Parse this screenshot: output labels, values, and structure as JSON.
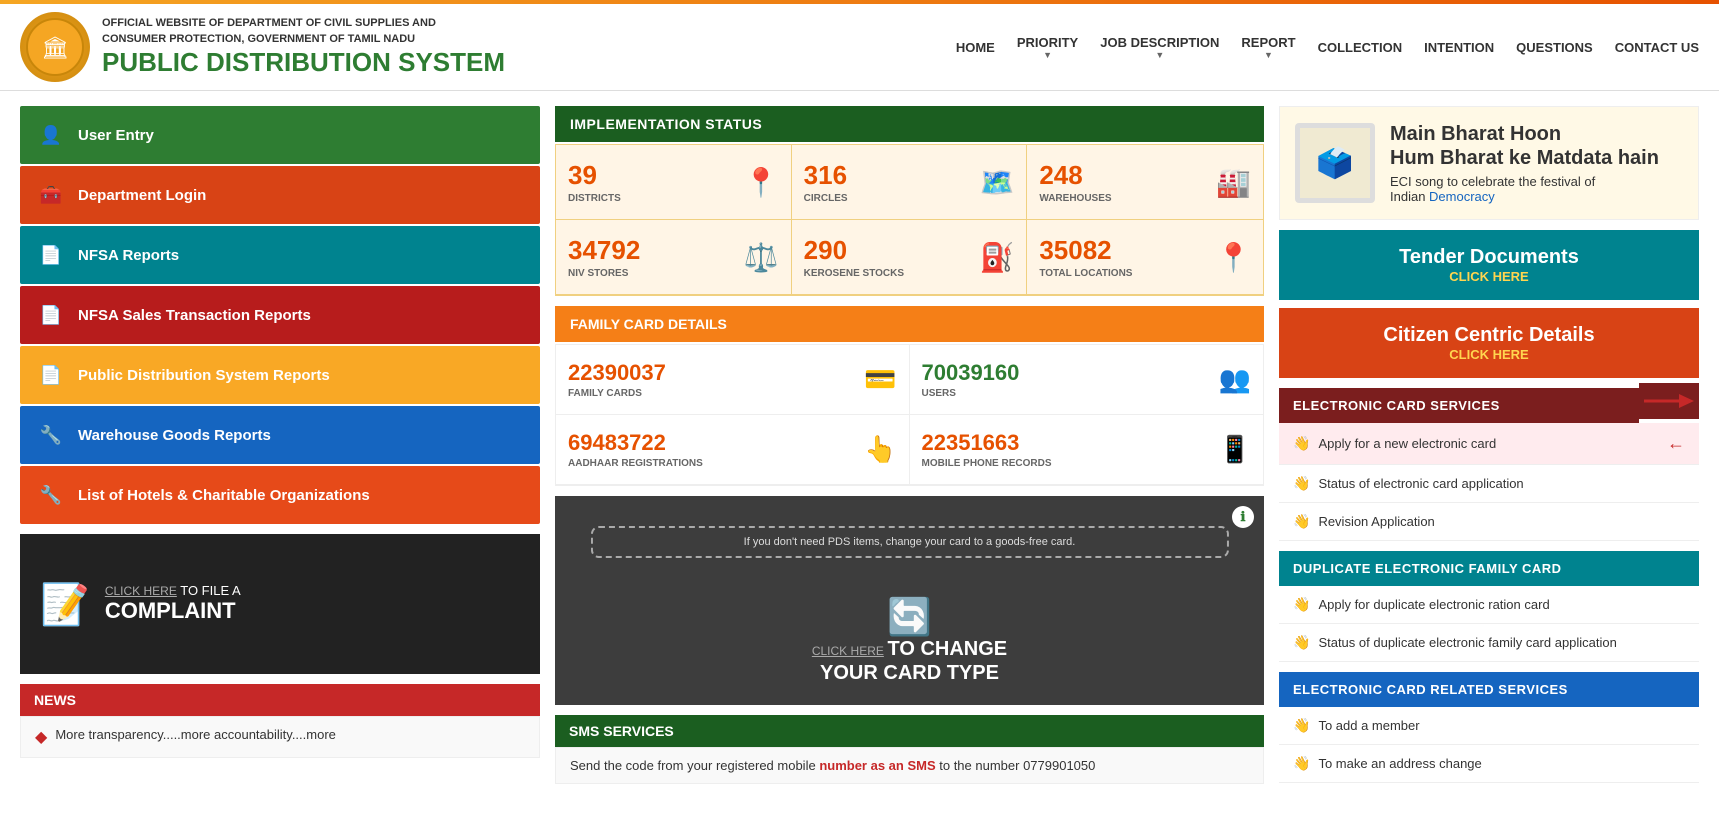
{
  "topbar": {
    "color": "#f5a623"
  },
  "header": {
    "subtitle_line1": "OFFICIAL WEBSITE OF DEPARTMENT OF CIVIL SUPPLIES AND",
    "subtitle_line2": "CONSUMER PROTECTION, GOVERNMENT OF TAMIL NADU",
    "title": "PUBLIC DISTRIBUTION SYSTEM"
  },
  "nav": {
    "items": [
      {
        "label": "HOME",
        "has_arrow": false
      },
      {
        "label": "PRIORITY",
        "has_arrow": true
      },
      {
        "label": "JOB DESCRIPTION",
        "has_arrow": true
      },
      {
        "label": "REPORT",
        "has_arrow": true
      },
      {
        "label": "COLLECTION",
        "has_arrow": false
      },
      {
        "label": "INTENTION",
        "has_arrow": false
      },
      {
        "label": "QUESTIONS",
        "has_arrow": false
      },
      {
        "label": "CONTACT US",
        "has_arrow": false
      }
    ]
  },
  "sidebar": {
    "items": [
      {
        "label": "User Entry",
        "icon": "👤",
        "color": "#2e7d32"
      },
      {
        "label": "Department Login",
        "icon": "🧰",
        "color": "#d84315"
      },
      {
        "label": "NFSA Reports",
        "icon": "📄",
        "color": "#00838f"
      },
      {
        "label": "NFSA Sales Transaction Reports",
        "icon": "📄",
        "color": "#b71c1c"
      },
      {
        "label": "Public Distribution System Reports",
        "icon": "📄",
        "color": "#f9a825"
      },
      {
        "label": "Warehouse Goods Reports",
        "icon": "🔧",
        "color": "#1565c0"
      },
      {
        "label": "List of Hotels & Charitable Organizations",
        "icon": "🔧",
        "color": "#e64a19"
      }
    ]
  },
  "complaint": {
    "click_label": "CLICK HERE",
    "text_line1": "TO FILE A",
    "text_line2": "COMPLAINT"
  },
  "news": {
    "header": "NEWS",
    "item": "More transparency.....more accountability....more"
  },
  "impl_status": {
    "header": "IMPLEMENTATION STATUS",
    "cells": [
      {
        "number": "39",
        "label": "DISTRICTS",
        "icon": "📍"
      },
      {
        "number": "316",
        "label": "CIRCLES",
        "icon": "🗺️"
      },
      {
        "number": "248",
        "label": "WAREHOUSES",
        "icon": "🏭"
      },
      {
        "number": "34792",
        "label": "NIV STORES",
        "icon": "⚖️"
      },
      {
        "number": "290",
        "label": "KEROSENE STOCKS",
        "icon": "⛽"
      },
      {
        "number": "35082",
        "label": "TOTAL LOCATIONS",
        "icon": "📍"
      }
    ]
  },
  "family_card": {
    "header": "FAMILY CARD DETAILS",
    "cells": [
      {
        "number": "22390037",
        "label": "FAMILY CARDS",
        "icon": "💳",
        "green": false
      },
      {
        "number": "70039160",
        "label": "USERS",
        "icon": "👥",
        "green": true
      },
      {
        "number": "69483722",
        "label": "AADHAAR REGISTRATIONS",
        "icon": "👆",
        "green": false
      },
      {
        "number": "22351663",
        "label": "MOBILE PHONE RECORDS",
        "icon": "📱",
        "green": false
      }
    ]
  },
  "change_card": {
    "dashed_text": "If you don't need PDS items, change your card to a goods-free card.",
    "click_label": "CLICK HERE",
    "text_line1": "TO CHANGE",
    "text_line2": "YOUR CARD TYPE"
  },
  "sms": {
    "header": "SMS SERVICES",
    "text": "Send the code from your registered mobile ",
    "highlight": "number as an SMS",
    "text2": " to the number 0779901050"
  },
  "banner": {
    "line1": "Main Bharat Hoon",
    "line2": "Hum Bharat ke Matdata hain",
    "line3": "ECI song to celebrate the festival of",
    "line4": "Indian ",
    "line4_blue": "Democracy"
  },
  "tender": {
    "main": "Tender Documents",
    "sub": "CLICK HERE"
  },
  "citizen": {
    "main": "Citizen Centric Details",
    "sub": "CLICK HERE"
  },
  "electronic_card": {
    "header": "ELECTRONIC CARD SERVICES",
    "items": [
      {
        "label": "Apply for a new electronic card",
        "highlighted": true
      },
      {
        "label": "Status of electronic card application",
        "highlighted": false
      },
      {
        "label": "Revision Application",
        "highlighted": false
      }
    ]
  },
  "duplicate_card": {
    "header": "DUPLICATE ELECTRONIC FAMILY CARD",
    "items": [
      {
        "label": "Apply for duplicate electronic ration card"
      },
      {
        "label": "Status of duplicate electronic family card application"
      }
    ]
  },
  "ecr_services": {
    "header": "ELECTRONIC CARD RELATED SERVICES",
    "items": [
      {
        "label": "To add a member"
      },
      {
        "label": "To make an address change"
      }
    ]
  }
}
